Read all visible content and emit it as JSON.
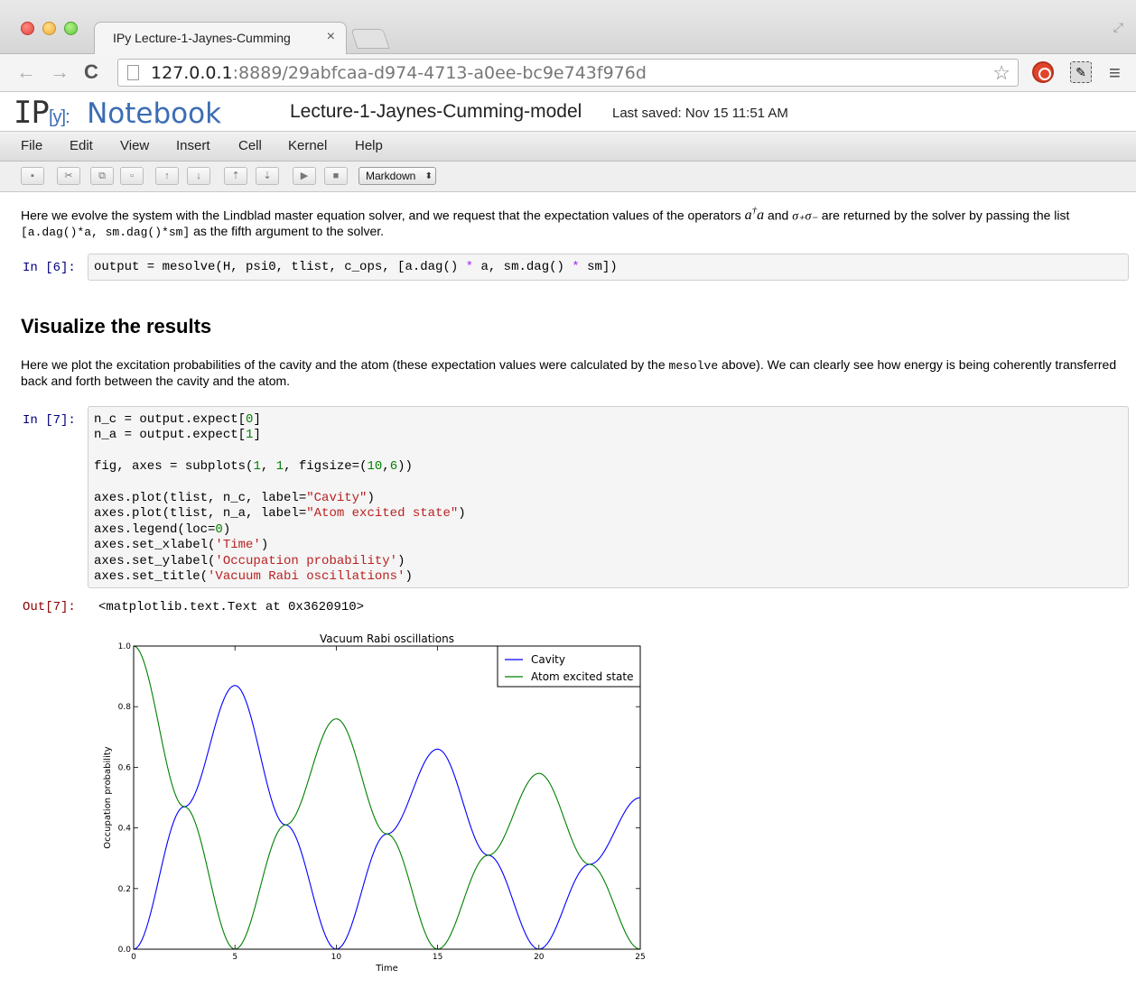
{
  "browser": {
    "tab_title": "IPy Lecture-1-Jaynes-Cumming",
    "tab_close": "×",
    "url_host": "127.0.0.1",
    "url_rest": ":8889/29abfcaa-d974-4713-a0ee-bc9e743f976d",
    "back": "←",
    "forward": "→",
    "reload": "C",
    "star": "☆",
    "menu": "≡"
  },
  "notebook": {
    "logo_ip": "IP",
    "logo_y": "[y]:",
    "logo_notebook": "Notebook",
    "name": "Lecture-1-Jaynes-Cumming-model",
    "last_saved": "Last saved: Nov 15 11:51 AM",
    "menu": [
      "File",
      "Edit",
      "View",
      "Insert",
      "Cell",
      "Kernel",
      "Help"
    ],
    "toolbar": [
      "▪",
      "✂",
      "⧉",
      "▫",
      "↑",
      "↓",
      "⇡",
      "⇣",
      "▶",
      "■"
    ],
    "cell_type": "Markdown",
    "cell_type_arrow": "⬍"
  },
  "cells": {
    "md1": {
      "t1": "Here we evolve the system with the Lindblad master equation solver, and we request that the expectation values of the operators ",
      "op1": "a",
      "op1_sup": "†",
      "op1b": "a",
      "t2": " and ",
      "op2": "σ₊σ₋",
      "t3": " are returned by the solver by passing the list ",
      "code": "[a.dag()*a, sm.dag()*sm]",
      "t4": " as the fifth argument to the solver."
    },
    "in6_prompt": "In [6]:",
    "in6_code": "output = mesolve(H, psi0, tlist, c_ops, [a.dag() * a, sm.dag() * sm])",
    "heading": "Visualize the results",
    "md2": {
      "t1": "Here we plot the excitation probabilities of the cavity and the atom (these expectation values were calculated by the ",
      "code": "mesolve",
      "t2": " above). We can clearly see how energy is being coherently transferred back and forth between the cavity and the atom."
    },
    "in7_prompt": "In [7]:",
    "in7_lines": [
      "n_c = output.expect[0]",
      "n_a = output.expect[1]",
      "",
      "fig, axes = subplots(1, 1, figsize=(10,6))",
      "",
      "axes.plot(tlist, n_c, label=\"Cavity\")",
      "axes.plot(tlist, n_a, label=\"Atom excited state\")",
      "axes.legend(loc=0)",
      "axes.set_xlabel('Time')",
      "axes.set_ylabel('Occupation probability')",
      "axes.set_title('Vacuum Rabi oscillations')"
    ],
    "out7_prompt": "Out[7]:",
    "out7_text": "<matplotlib.text.Text at 0x3620910>"
  },
  "chart_data": {
    "type": "line",
    "title": "Vacuum Rabi oscillations",
    "xlabel": "Time",
    "ylabel": "Occupation probability",
    "xlim": [
      0,
      25
    ],
    "ylim": [
      0.0,
      1.0
    ],
    "x_ticks": [
      "0",
      "5",
      "10",
      "15",
      "20",
      "25"
    ],
    "y_ticks": [
      "0.0",
      "0.2",
      "0.4",
      "0.6",
      "0.8",
      "1.0"
    ],
    "legend_position": "top-right",
    "grid": false,
    "series": [
      {
        "name": "Cavity",
        "color": "#0000ff",
        "x": [
          0,
          2.5,
          5,
          7.5,
          10,
          12.5,
          15,
          17.5,
          20,
          22.5,
          25
        ],
        "y": [
          0.0,
          0.47,
          0.87,
          0.41,
          0.0,
          0.38,
          0.66,
          0.31,
          0.0,
          0.28,
          0.5
        ]
      },
      {
        "name": "Atom excited state",
        "color": "#008000",
        "x": [
          0,
          2.5,
          5,
          7.5,
          10,
          12.5,
          15,
          17.5,
          20,
          22.5,
          25
        ],
        "y": [
          1.0,
          0.47,
          0.0,
          0.41,
          0.76,
          0.38,
          0.0,
          0.31,
          0.58,
          0.28,
          0.0
        ]
      }
    ]
  }
}
